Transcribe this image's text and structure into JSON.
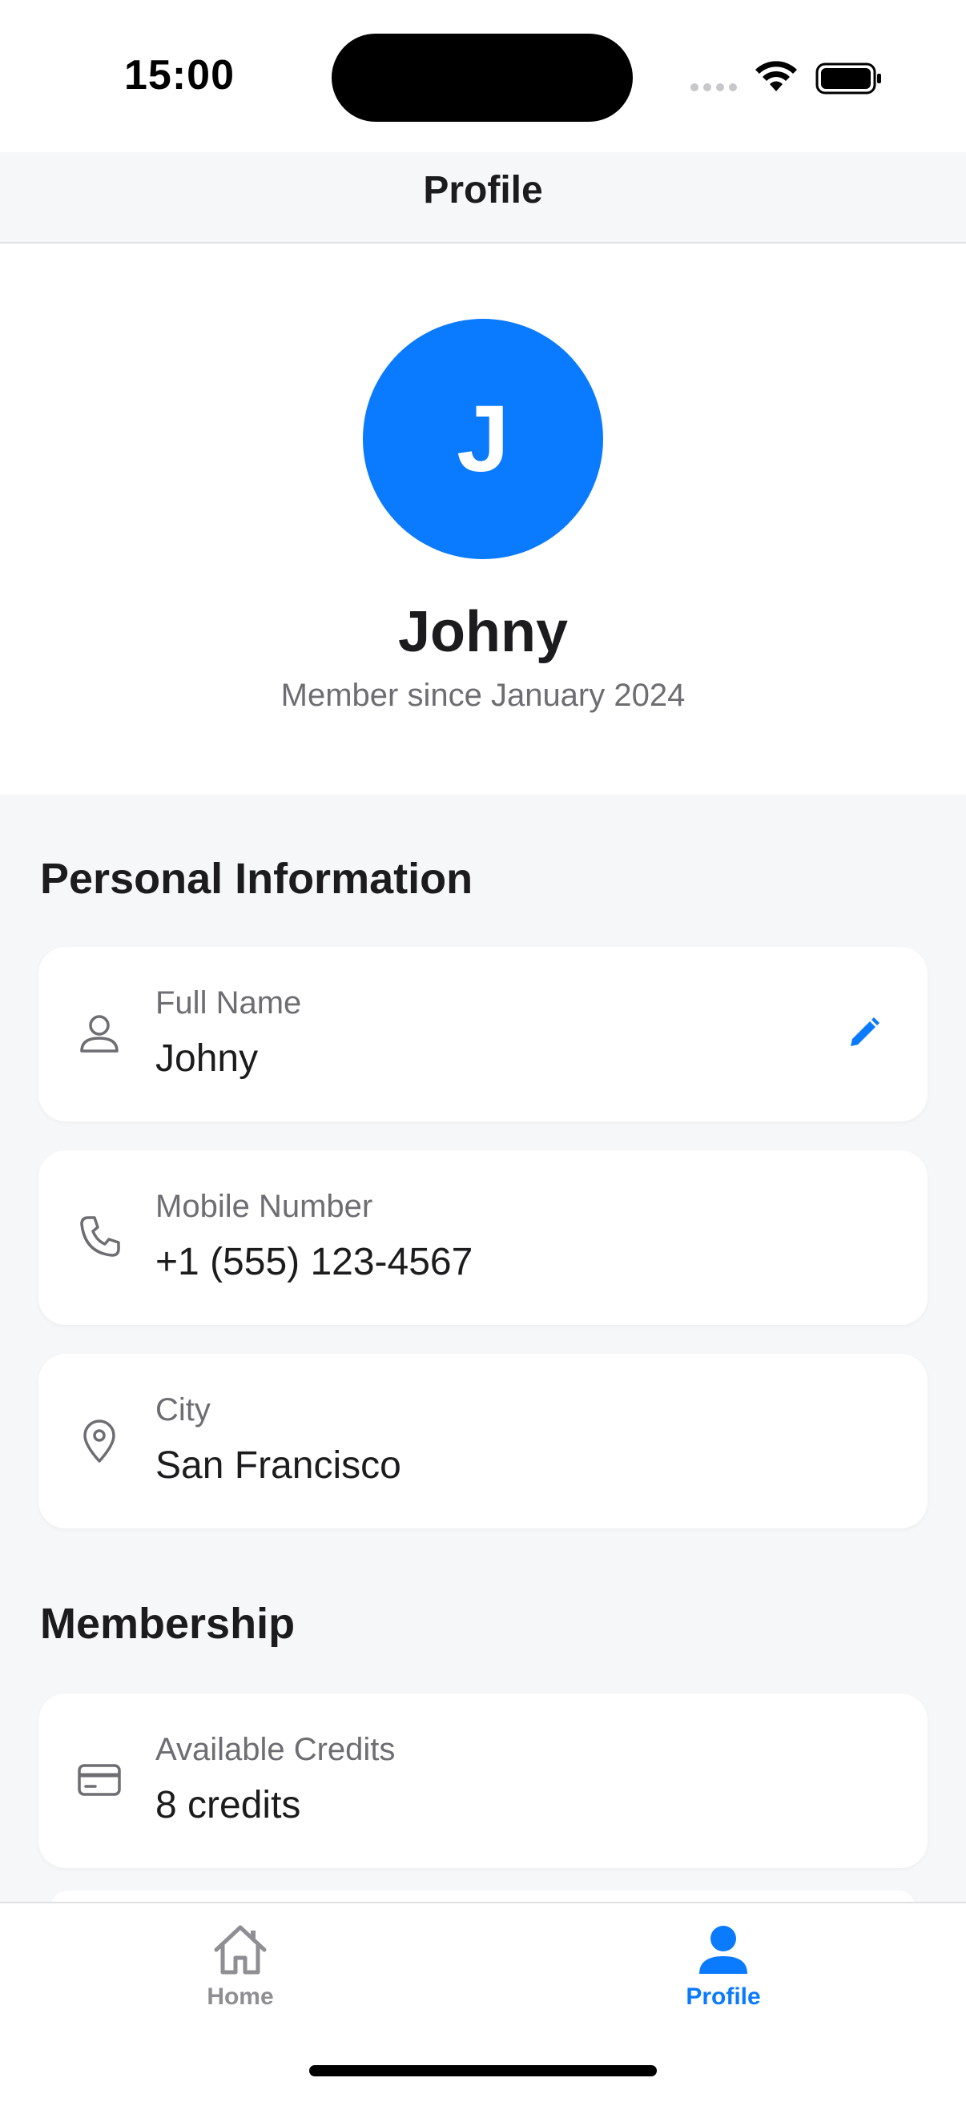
{
  "status_bar": {
    "time": "15:00"
  },
  "header": {
    "title": "Profile"
  },
  "profile": {
    "avatar_initial": "J",
    "name": "Johny",
    "member_since": "Member since January 2024"
  },
  "sections": {
    "personal": {
      "title": "Personal Information",
      "full_name": {
        "label": "Full Name",
        "value": "Johny",
        "icon": "person-icon"
      },
      "mobile": {
        "label": "Mobile Number",
        "value": "+1 (555) 123-4567",
        "icon": "phone-icon"
      },
      "city": {
        "label": "City",
        "value": "San Francisco",
        "icon": "location-pin-icon"
      }
    },
    "membership": {
      "title": "Membership",
      "credits": {
        "label": "Available Credits",
        "value": "8 credits",
        "icon": "credit-card-icon"
      }
    }
  },
  "tab_bar": {
    "home_label": "Home",
    "profile_label": "Profile",
    "active": "profile"
  },
  "colors": {
    "accent": "#0a7aff",
    "inactive": "#8e8e93",
    "background": "#f6f7f9"
  }
}
